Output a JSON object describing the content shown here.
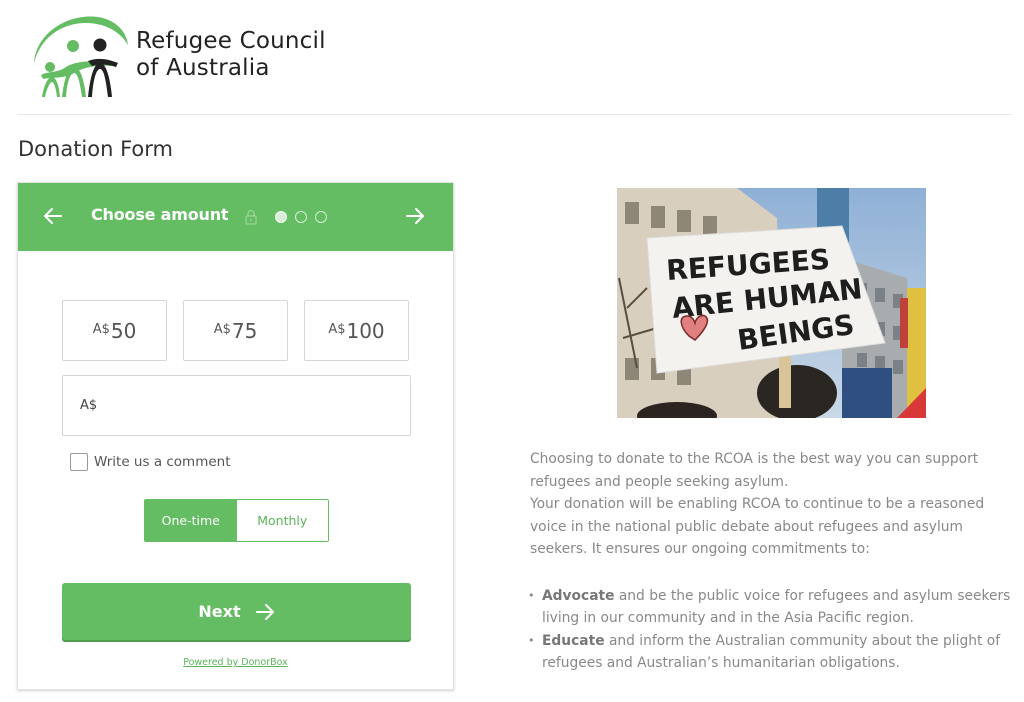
{
  "brand": {
    "name_line1": "Refugee Council",
    "name_line2": "of Australia",
    "colors": {
      "green": "#64bd63",
      "dark": "#222222"
    }
  },
  "page": {
    "title": "Donation Form"
  },
  "form": {
    "header": {
      "back_icon": "arrow-left-icon",
      "title": "Choose amount",
      "lock_icon": "lock-icon",
      "steps_total": 3,
      "step_current": 1,
      "next_icon": "arrow-right-icon"
    },
    "amount_options": [
      {
        "currency": "A$",
        "value": "50"
      },
      {
        "currency": "A$",
        "value": "75"
      },
      {
        "currency": "A$",
        "value": "100"
      }
    ],
    "custom_amount": {
      "currency": "A$",
      "value": "",
      "placeholder": ""
    },
    "comment_checkbox": {
      "label": "Write us a comment",
      "checked": false
    },
    "frequency": {
      "options": [
        "One-time",
        "Monthly"
      ],
      "selected": "One-time"
    },
    "next_button": {
      "label": "Next",
      "icon": "arrow-right-icon"
    },
    "powered_by": "Powered by DonorBox",
    "accent_color": "#64bd63"
  },
  "sidebar": {
    "image_alt": "Protest sign: Refugees are human beings",
    "image_sign_lines": [
      "REFUGEES",
      "ARE HUMAN",
      "BEINGS"
    ],
    "paragraph1": "Choosing to donate to the RCOA is the best way you can support refugees and people seeking asylum.",
    "paragraph2": "Your donation will be enabling RCOA to continue to be a reasoned voice in the national public debate about refugees and asylum seekers. It ensures our ongoing commitments to:",
    "commitments": [
      {
        "bold": "Advocate",
        "text": " and be the public voice for refugees and asylum seekers living in our community and in the Asia Pacific region."
      },
      {
        "bold": "Educate",
        "text": " and inform the Australian community about the plight of refugees and Australian’s humanitarian obligations."
      }
    ]
  }
}
